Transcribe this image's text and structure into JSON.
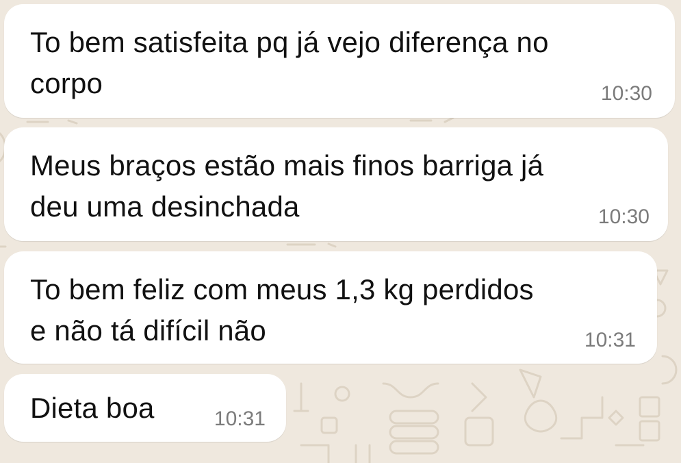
{
  "chat": {
    "background_color": "#efe8de",
    "bubble_color": "#ffffff",
    "messages": [
      {
        "text": "To bem satisfeita pq já vejo diferença no\ncorpo",
        "time": "10:30"
      },
      {
        "text": "Meus braços estão mais finos barriga já\ndeu uma desinchada",
        "time": "10:30"
      },
      {
        "text": "To bem feliz com meus 1,3 kg perdidos\ne não tá difícil não",
        "time": "10:31"
      },
      {
        "text": "Dieta boa",
        "time": "10:31"
      }
    ]
  }
}
